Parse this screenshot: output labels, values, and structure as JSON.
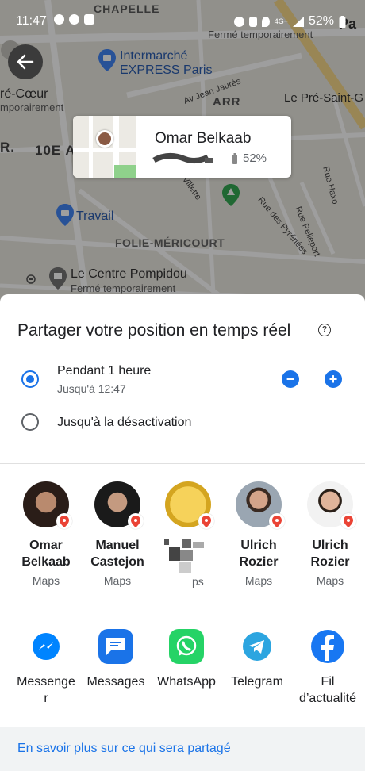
{
  "status_bar": {
    "time": "11:47",
    "network": "4G+",
    "battery": "52%"
  },
  "map": {
    "labels": {
      "chapelle": "CHAPELLE",
      "ferme_top": "Fermé temporairement",
      "intermarche": "Intermarché\nEXPRESS Paris",
      "coeur": "ré-Cœur",
      "coeur_sub": "mporairement",
      "jaures": "Av Jean Jaurès",
      "pre_saint": "Le Pré-Saint-G",
      "arr_10": "10E A",
      "r": "R.",
      "travail": "Travail",
      "folie": "FOLIE-MÉRICOURT",
      "pompidou": "Le Centre Pompidou",
      "pompidou_sub": "Fermé temporairement",
      "villette": "Villette",
      "rue_pyrenees": "Rue des Pyrénées",
      "rue_pelleport": "Rue Pelleport",
      "rue_haxo": "Rue Haxo",
      "pa": "Pa",
      "arr": "ARR"
    },
    "card": {
      "name": "Omar Belkaab",
      "battery": "52%"
    }
  },
  "sheet": {
    "title": "Partager votre position en temps réel",
    "option1": {
      "label": "Pendant 1 heure",
      "sub": "Jusqu'à 12:47",
      "selected": true
    },
    "option2": {
      "label": "Jusqu'à la désactivation",
      "selected": false
    },
    "minus": "−",
    "plus": "+"
  },
  "contacts": [
    {
      "name": "Omar\nBelkaab",
      "app": "Maps"
    },
    {
      "name": "Manuel\nCastejon",
      "app": "Maps"
    },
    {
      "name": "",
      "app": "ps"
    },
    {
      "name": "Ulrich\nRozier",
      "app": "Maps"
    },
    {
      "name": "Ulrich\nRozier",
      "app": "Maps"
    }
  ],
  "apps": [
    {
      "label": "Messenge\nr",
      "icon": "messenger-icon",
      "color": "#0084ff"
    },
    {
      "label": "Messages",
      "icon": "messages-icon",
      "color": "#1a73e8"
    },
    {
      "label": "WhatsApp",
      "icon": "whatsapp-icon",
      "color": "#25d366"
    },
    {
      "label": "Telegram",
      "icon": "telegram-icon",
      "color": "#2ca5e0"
    },
    {
      "label": "Fil\nd’actualité",
      "icon": "facebook-icon",
      "color": "#1877f2"
    }
  ],
  "footer": {
    "link": "En savoir plus sur ce qui sera partagé"
  },
  "colors": {
    "accent": "#1a73e8"
  }
}
